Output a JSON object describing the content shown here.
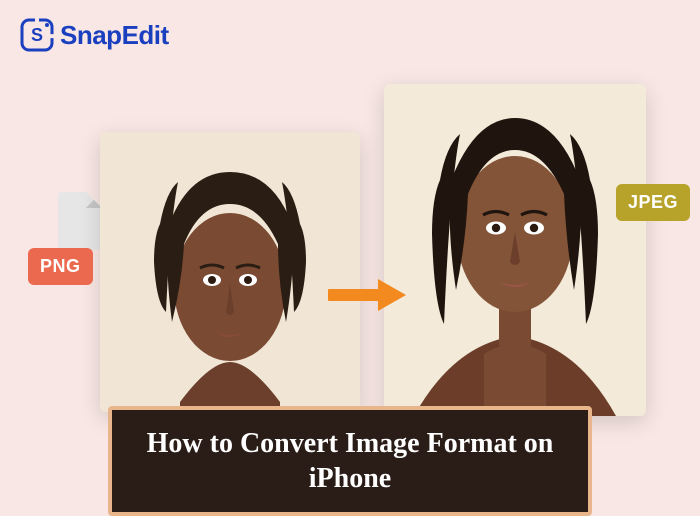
{
  "brand": {
    "name": "SnapEdit",
    "logo_color": "#1a3fbf"
  },
  "badges": {
    "source_format": "PNG",
    "target_format": "JPEG"
  },
  "colors": {
    "badge_png": "#eb6a4f",
    "badge_jpeg": "#b7a32a",
    "arrow": "#f28a1f",
    "title_border": "#e9b58a",
    "title_bg": "#2a1c17"
  },
  "title": "How to Convert Image Format on iPhone"
}
